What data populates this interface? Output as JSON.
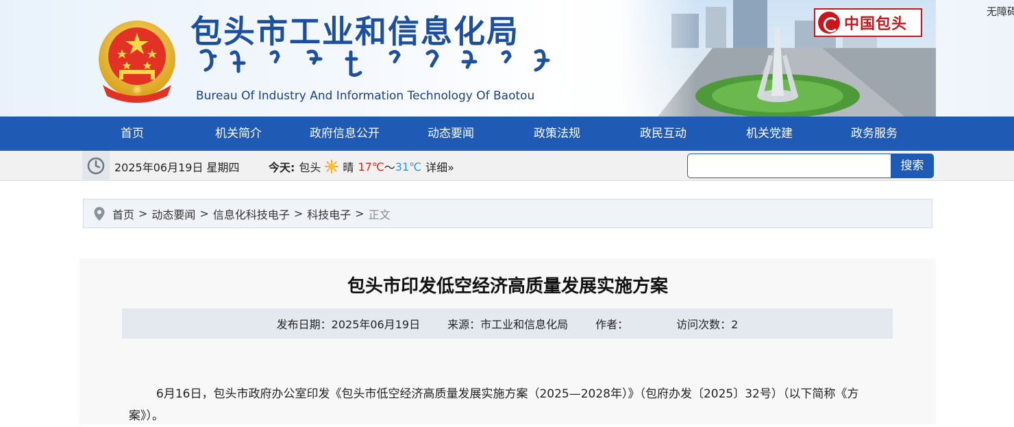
{
  "header": {
    "title_cn": "包头市工业和信息化局",
    "title_en": "Bureau Of Industry And Information Technology  Of  Baotou",
    "cn_baotou_label": "中国包头",
    "accessibility_label": "无障碍"
  },
  "nav": {
    "items": [
      {
        "label": "首页"
      },
      {
        "label": "机关简介"
      },
      {
        "label": "政府信息公开"
      },
      {
        "label": "动态要闻"
      },
      {
        "label": "政策法规"
      },
      {
        "label": "政民互动"
      },
      {
        "label": "机关党建"
      },
      {
        "label": "政务服务"
      }
    ]
  },
  "infobar": {
    "date": "2025年06月19日 星期四",
    "weather_label": "今天:",
    "city": "包头",
    "condition": "晴",
    "low": "17℃",
    "tilde": "～",
    "high": "31℃",
    "detail": "详细»",
    "search_value": "",
    "search_button": "搜索"
  },
  "breadcrumb": {
    "items": [
      "首页",
      "动态要闻",
      "信息化科技电子",
      "科技电子"
    ],
    "current": "正文",
    "separator": ">"
  },
  "article": {
    "title": "包头市印发低空经济高质量发展实施方案",
    "meta": {
      "date": "发布日期：2025年06月19日",
      "source": "来源：市工业和信息化局",
      "author": "作者：",
      "visits": "访问次数：2"
    },
    "paragraph": "6月16日，包头市政府办公室印发《包头市低空经济高质量发展实施方案（2025—2028年）》（包府办发〔2025〕32号）（以下简称《方案》）。"
  },
  "colors": {
    "brand_blue": "#1f5ab4",
    "title_blue": "#1c4f9c",
    "accent_red": "#c8161d",
    "temp_low": "#e02020",
    "temp_high": "#3a8fd8"
  },
  "icons": {
    "emblem": "national-emblem-icon",
    "clock": "clock-icon",
    "sun": "sun-icon",
    "location": "location-pin-icon"
  }
}
